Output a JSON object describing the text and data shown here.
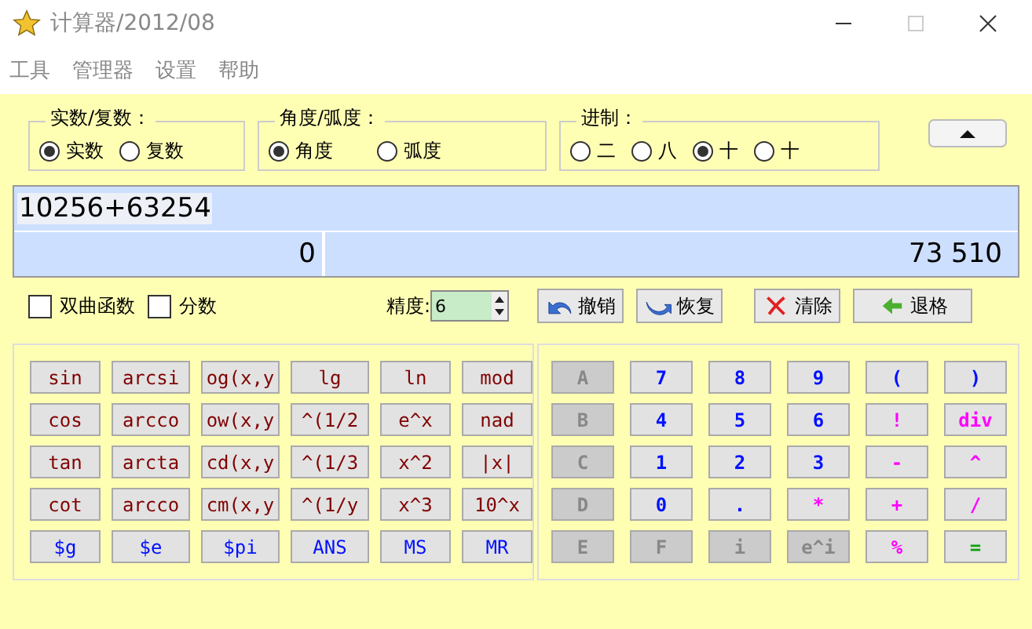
{
  "window": {
    "title": "计算器/2012/08"
  },
  "menu": [
    "工具",
    "管理器",
    "设置",
    "帮助"
  ],
  "groups": [
    {
      "title": "实数/复数：",
      "options": [
        {
          "label": "实数",
          "selected": true
        },
        {
          "label": "复数",
          "selected": false
        }
      ]
    },
    {
      "title": "角度/弧度：",
      "options": [
        {
          "label": "角度",
          "selected": true
        },
        {
          "label": "弧度",
          "selected": false
        }
      ]
    },
    {
      "title": "进制：",
      "options": [
        {
          "label": "二",
          "selected": false
        },
        {
          "label": "八",
          "selected": false
        },
        {
          "label": "十",
          "selected": true
        },
        {
          "label": "十",
          "selected": false
        }
      ]
    }
  ],
  "display": {
    "expression": "10256+63254",
    "imaginary": "0",
    "result": "73 510"
  },
  "options": [
    {
      "label": "双曲函数",
      "checked": false
    },
    {
      "label": "分数",
      "checked": false
    }
  ],
  "precision": {
    "label": "精度:",
    "value": "6"
  },
  "actions": [
    {
      "kind": "undo",
      "label": "撤销"
    },
    {
      "kind": "redo",
      "label": "恢复"
    },
    {
      "kind": "clear",
      "label": "清除"
    },
    {
      "kind": "back",
      "label": "退格"
    }
  ],
  "function_keys": [
    [
      {
        "label": "sin",
        "kind": "func"
      },
      {
        "label": "arcsi",
        "kind": "func"
      },
      {
        "label": "og(x,y",
        "kind": "func"
      },
      {
        "label": "lg",
        "kind": "func"
      },
      {
        "label": "ln",
        "kind": "func"
      },
      {
        "label": "mod",
        "kind": "func"
      }
    ],
    [
      {
        "label": "cos",
        "kind": "func"
      },
      {
        "label": "arcco",
        "kind": "func"
      },
      {
        "label": "ow(x,y",
        "kind": "func"
      },
      {
        "label": "^(1/2",
        "kind": "func"
      },
      {
        "label": "e^x",
        "kind": "func"
      },
      {
        "label": "nad",
        "kind": "func"
      }
    ],
    [
      {
        "label": "tan",
        "kind": "func"
      },
      {
        "label": "arcta",
        "kind": "func"
      },
      {
        "label": "cd(x,y",
        "kind": "func"
      },
      {
        "label": "^(1/3",
        "kind": "func"
      },
      {
        "label": "x^2",
        "kind": "func"
      },
      {
        "label": "|x|",
        "kind": "func"
      }
    ],
    [
      {
        "label": "cot",
        "kind": "func"
      },
      {
        "label": "arcco",
        "kind": "func"
      },
      {
        "label": "cm(x,y",
        "kind": "func"
      },
      {
        "label": "^(1/y",
        "kind": "func"
      },
      {
        "label": "x^3",
        "kind": "func"
      },
      {
        "label": "10^x",
        "kind": "func"
      }
    ],
    [
      {
        "label": "$g",
        "kind": "const"
      },
      {
        "label": "$e",
        "kind": "const"
      },
      {
        "label": "$pi",
        "kind": "const"
      },
      {
        "label": "ANS",
        "kind": "const"
      },
      {
        "label": "MS",
        "kind": "const"
      },
      {
        "label": "MR",
        "kind": "const"
      }
    ]
  ],
  "number_keys": [
    [
      {
        "label": "A",
        "kind": "digit",
        "disabled": true
      },
      {
        "label": "7",
        "kind": "digit",
        "disabled": false
      },
      {
        "label": "8",
        "kind": "digit",
        "disabled": false
      },
      {
        "label": "9",
        "kind": "digit",
        "disabled": false
      },
      {
        "label": "(",
        "kind": "digit",
        "disabled": false
      },
      {
        "label": ")",
        "kind": "digit",
        "disabled": false
      }
    ],
    [
      {
        "label": "B",
        "kind": "digit",
        "disabled": true
      },
      {
        "label": "4",
        "kind": "digit",
        "disabled": false
      },
      {
        "label": "5",
        "kind": "digit",
        "disabled": false
      },
      {
        "label": "6",
        "kind": "digit",
        "disabled": false
      },
      {
        "label": "!",
        "kind": "op",
        "disabled": false
      },
      {
        "label": "div",
        "kind": "op",
        "disabled": false
      }
    ],
    [
      {
        "label": "C",
        "kind": "digit",
        "disabled": true
      },
      {
        "label": "1",
        "kind": "digit",
        "disabled": false
      },
      {
        "label": "2",
        "kind": "digit",
        "disabled": false
      },
      {
        "label": "3",
        "kind": "digit",
        "disabled": false
      },
      {
        "label": "-",
        "kind": "op",
        "disabled": false
      },
      {
        "label": "^",
        "kind": "op",
        "disabled": false
      }
    ],
    [
      {
        "label": "D",
        "kind": "digit",
        "disabled": true
      },
      {
        "label": "0",
        "kind": "digit",
        "disabled": false
      },
      {
        "label": ".",
        "kind": "digit",
        "disabled": false
      },
      {
        "label": "*",
        "kind": "op",
        "disabled": false
      },
      {
        "label": "+",
        "kind": "op",
        "disabled": false
      },
      {
        "label": "/",
        "kind": "op",
        "disabled": false
      }
    ],
    [
      {
        "label": "E",
        "kind": "digit",
        "disabled": true
      },
      {
        "label": "F",
        "kind": "digit",
        "disabled": true
      },
      {
        "label": "i",
        "kind": "digit",
        "disabled": true
      },
      {
        "label": "e^i",
        "kind": "digit",
        "disabled": true
      },
      {
        "label": "%",
        "kind": "op",
        "disabled": false
      },
      {
        "label": "=",
        "kind": "eq",
        "disabled": false
      }
    ]
  ]
}
